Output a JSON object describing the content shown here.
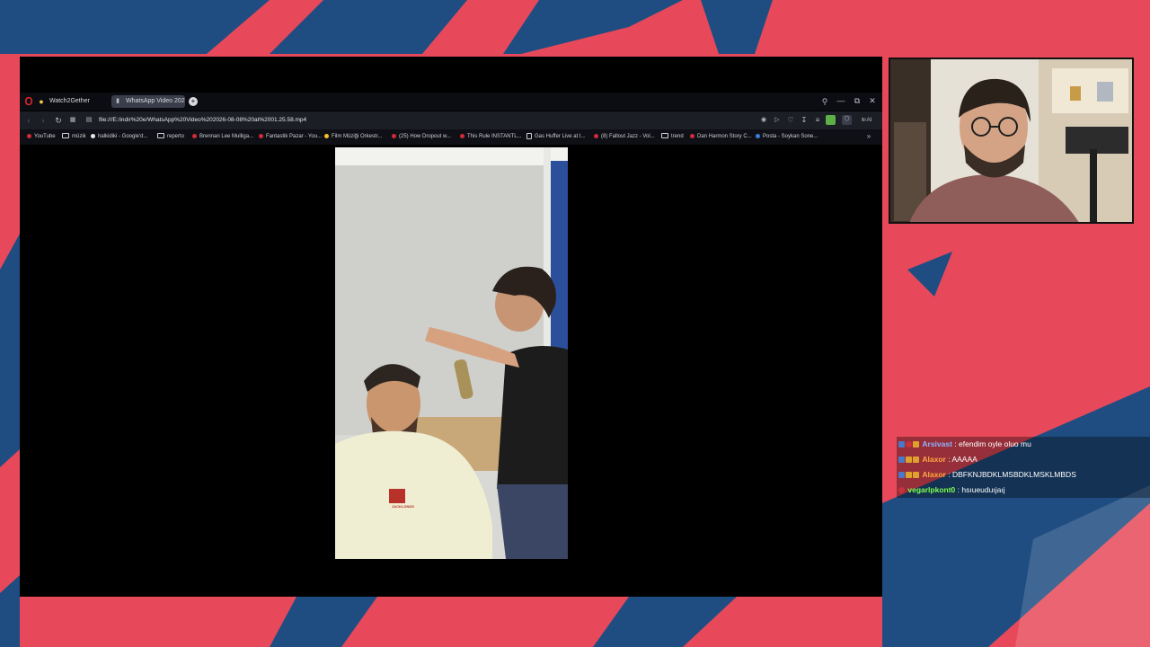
{
  "browser": {
    "tabs": [
      {
        "label": "Watch2Gether",
        "active": false
      },
      {
        "label": "WhatsApp Video 202",
        "active": true
      }
    ],
    "new_tab_label": "+",
    "url": "file:///E:/indir%20e/WhatsApp%20Video%202026-08-08%20at%2001.25.58.mp4",
    "bookmarks": [
      {
        "label": "YouTube",
        "icon": "youtube"
      },
      {
        "label": "müzik",
        "icon": "folder"
      },
      {
        "label": "halkidiki - Google'd...",
        "icon": "google"
      },
      {
        "label": "reperto",
        "icon": "folder"
      },
      {
        "label": "Brennan Lee Mulliga...",
        "icon": "youtube"
      },
      {
        "label": "Fantastik Pazar - You...",
        "icon": "youtube"
      },
      {
        "label": "Film Müziği Orkestr...",
        "icon": "drive"
      },
      {
        "label": "(25) How Dropout w...",
        "icon": "youtube"
      },
      {
        "label": "This Rule INSTANTL...",
        "icon": "youtube"
      },
      {
        "label": "Gas Huffer Live at I...",
        "icon": "doc"
      },
      {
        "label": "(8) Fallout Jazz - Vol...",
        "icon": "youtube"
      },
      {
        "label": "trend",
        "icon": "folder"
      },
      {
        "label": "Dan Harmon Story C...",
        "icon": "youtube"
      },
      {
        "label": "Posta - Soykan Sone...",
        "icon": "mail"
      }
    ],
    "ai_label": "AI",
    "more_bookmarks": "»"
  },
  "chat": {
    "messages": [
      {
        "user": "Arsivast",
        "text": "efendim oyle oluo mu",
        "color": "#8fb3ff"
      },
      {
        "user": "Alaxor",
        "text": "AAAAA",
        "color": "#ffa640"
      },
      {
        "user": "Alaxor",
        "text": "DBFKNJBDKLMSBDKLMSKLMBDS",
        "color": "#ffa640"
      },
      {
        "user": "vegarlpkont0",
        "text": "hsıueuduıjaıj",
        "color": "#7dff4a"
      }
    ],
    "separator": " : "
  },
  "video_shirt_text": "JACKLONDS"
}
